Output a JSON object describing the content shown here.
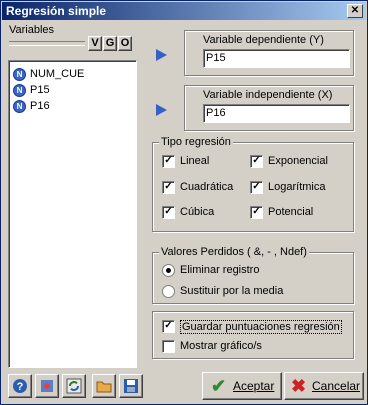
{
  "window": {
    "title": "Regresión simple",
    "close_label": "✕"
  },
  "variables": {
    "label": "Variables",
    "buttons": [
      "V",
      "G",
      "O"
    ],
    "items": [
      "NUM_CUE",
      "P15",
      "P16"
    ],
    "item_icon": "N"
  },
  "dependent": {
    "label": "Variable dependiente (Y)",
    "value": "P15"
  },
  "independent": {
    "label": "Variable independiente (X)",
    "value": "P16"
  },
  "tipo": {
    "label": "Tipo regresión",
    "options": [
      {
        "label": "Lineal",
        "checked": true
      },
      {
        "label": "Exponencial",
        "checked": true
      },
      {
        "label": "Cuadrática",
        "checked": true
      },
      {
        "label": "Logarítmica",
        "checked": true
      },
      {
        "label": "Cúbica",
        "checked": true
      },
      {
        "label": "Potencial",
        "checked": true
      }
    ]
  },
  "perdidos": {
    "label": "Valores Perdidos ( &, - , Ndef)",
    "options": [
      {
        "label": "Eliminar registro",
        "selected": true
      },
      {
        "label": "Sustituir por la media",
        "selected": false
      }
    ]
  },
  "extras": [
    {
      "label": "Guardar puntuaciones regresión",
      "checked": true
    },
    {
      "label": "Mostrar gráfico/s",
      "checked": false
    }
  ],
  "toolbar": {
    "icons": [
      "help-icon",
      "settings-icon",
      "refresh-icon",
      "folder-icon",
      "save-icon"
    ]
  },
  "actions": {
    "accept_label": "Aceptar",
    "cancel_label": "Cancelar"
  },
  "colors": {
    "title_start": "#0a246a",
    "title_end": "#a6caf0",
    "accept": "#2e8b2e",
    "cancel": "#cc2222"
  }
}
